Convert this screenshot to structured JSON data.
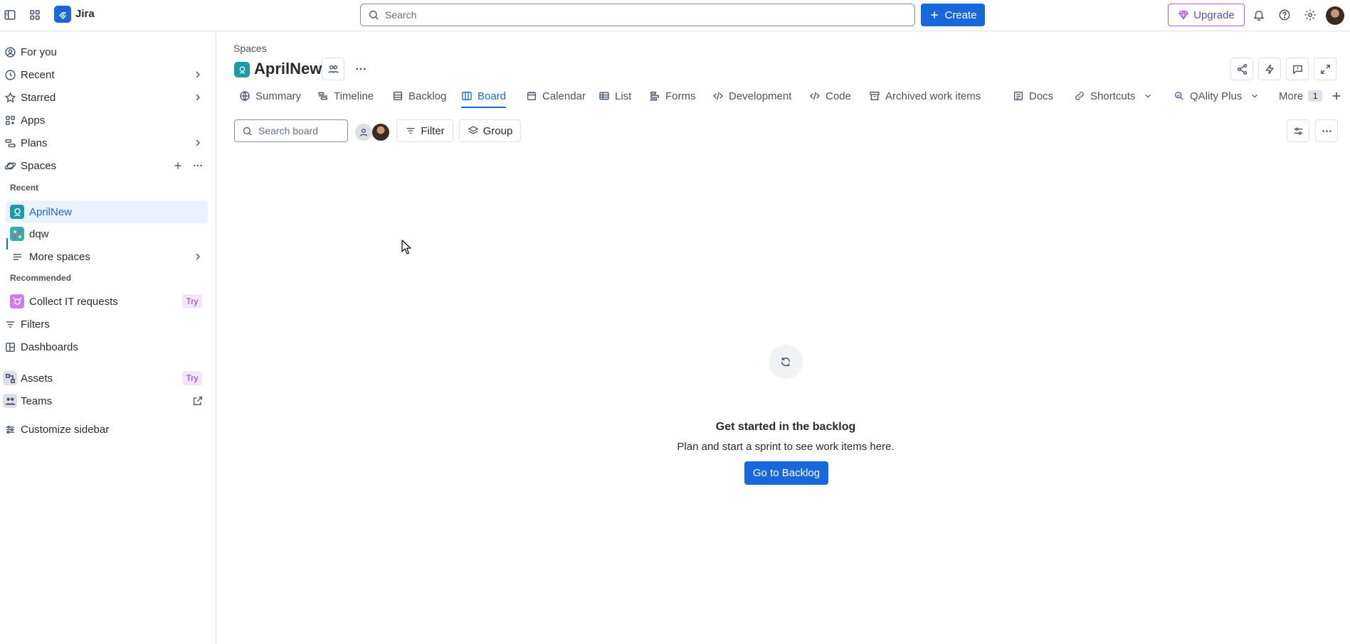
{
  "app": {
    "name": "Jira"
  },
  "topbar": {
    "search_placeholder": "Search",
    "create_label": "Create",
    "upgrade_label": "Upgrade"
  },
  "sidebar": {
    "nav": [
      {
        "label": "For you",
        "icon": "user-circle-icon"
      },
      {
        "label": "Recent",
        "icon": "clock-icon"
      },
      {
        "label": "Starred",
        "icon": "star-icon"
      },
      {
        "label": "Apps",
        "icon": "apps-icon"
      },
      {
        "label": "Plans",
        "icon": "plans-icon"
      },
      {
        "label": "Spaces",
        "icon": "planet-icon"
      }
    ],
    "recent_heading": "Recent",
    "recent_spaces": [
      {
        "label": "AprilNew"
      },
      {
        "label": "dqw"
      }
    ],
    "more_spaces": "More spaces",
    "recommended_heading": "Recommended",
    "recommended": {
      "label": "Collect IT requests",
      "badge": "Try"
    },
    "filters": "Filters",
    "dashboards": "Dashboards",
    "assets": {
      "label": "Assets",
      "badge": "Try"
    },
    "teams": "Teams",
    "customize": "Customize sidebar"
  },
  "main": {
    "breadcrumb": "Spaces",
    "space_title": "AprilNew",
    "tabs": [
      {
        "label": "Summary",
        "icon": "globe-icon"
      },
      {
        "label": "Timeline",
        "icon": "timeline-icon"
      },
      {
        "label": "Backlog",
        "icon": "backlog-icon"
      },
      {
        "label": "Board",
        "icon": "board-icon"
      },
      {
        "label": "Calendar",
        "icon": "calendar-icon"
      },
      {
        "label": "List",
        "icon": "list-icon"
      },
      {
        "label": "Forms",
        "icon": "forms-icon"
      },
      {
        "label": "Development",
        "icon": "code-icon"
      },
      {
        "label": "Code",
        "icon": "code-icon"
      },
      {
        "label": "Archived work items",
        "icon": "archive-icon"
      },
      {
        "label": "Docs",
        "icon": "docs-icon"
      },
      {
        "label": "Shortcuts",
        "icon": "link-icon"
      },
      {
        "label": "QAlity Plus",
        "icon": "qality-icon"
      },
      {
        "label": "More",
        "count": "1"
      }
    ],
    "active_tab": "Board",
    "board_search_placeholder": "Search board",
    "filter_label": "Filter",
    "group_label": "Group",
    "empty_state": {
      "title": "Get started in the backlog",
      "description": "Plan and start a sprint to see work items here.",
      "button": "Go to Backlog"
    }
  },
  "colors": {
    "brand": "#1868db",
    "upgrade": "#af59e1",
    "space_icon": "#1d9aaa",
    "active_bg": "#e9f2fe"
  }
}
